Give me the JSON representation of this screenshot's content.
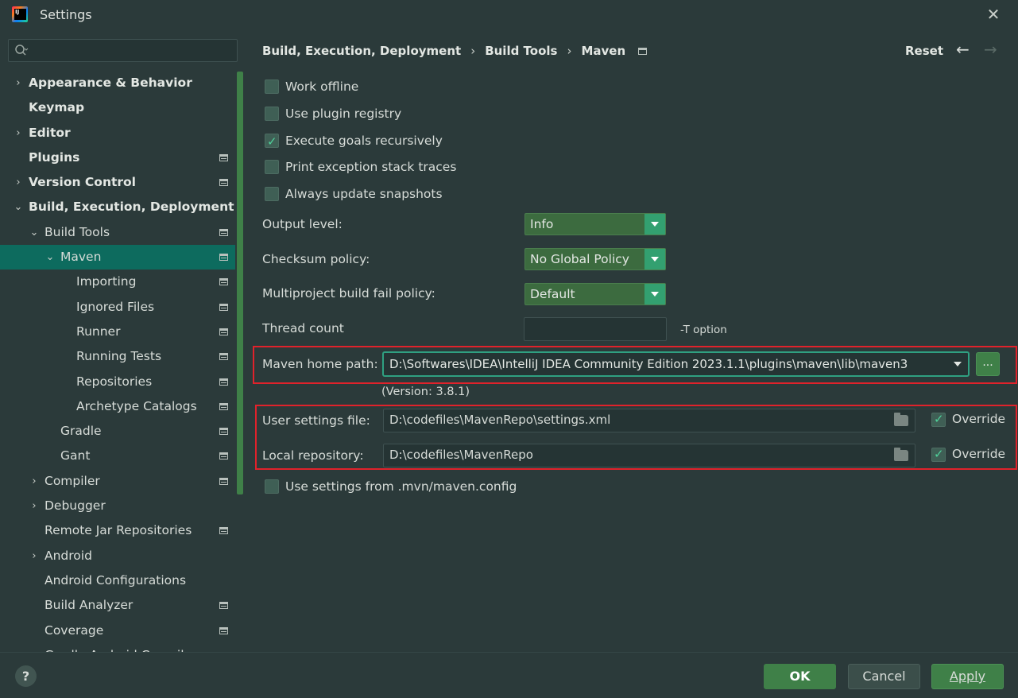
{
  "window": {
    "title": "Settings"
  },
  "search": {
    "placeholder": ""
  },
  "tree": [
    {
      "label": "Appearance & Behavior",
      "arrow": "›",
      "indent": 0,
      "bold": true,
      "proj": false,
      "selected": false
    },
    {
      "label": "Keymap",
      "arrow": "",
      "indent": 0,
      "bold": true,
      "proj": false,
      "selected": false
    },
    {
      "label": "Editor",
      "arrow": "›",
      "indent": 0,
      "bold": true,
      "proj": false,
      "selected": false
    },
    {
      "label": "Plugins",
      "arrow": "",
      "indent": 0,
      "bold": true,
      "proj": true,
      "selected": false
    },
    {
      "label": "Version Control",
      "arrow": "›",
      "indent": 0,
      "bold": true,
      "proj": true,
      "selected": false
    },
    {
      "label": "Build, Execution, Deployment",
      "arrow": "⌄",
      "indent": 0,
      "bold": true,
      "proj": false,
      "selected": false
    },
    {
      "label": "Build Tools",
      "arrow": "⌄",
      "indent": 1,
      "bold": false,
      "proj": true,
      "selected": false
    },
    {
      "label": "Maven",
      "arrow": "⌄",
      "indent": 2,
      "bold": false,
      "proj": true,
      "selected": true
    },
    {
      "label": "Importing",
      "arrow": "",
      "indent": 3,
      "bold": false,
      "proj": true,
      "selected": false
    },
    {
      "label": "Ignored Files",
      "arrow": "",
      "indent": 3,
      "bold": false,
      "proj": true,
      "selected": false
    },
    {
      "label": "Runner",
      "arrow": "",
      "indent": 3,
      "bold": false,
      "proj": true,
      "selected": false
    },
    {
      "label": "Running Tests",
      "arrow": "",
      "indent": 3,
      "bold": false,
      "proj": true,
      "selected": false
    },
    {
      "label": "Repositories",
      "arrow": "",
      "indent": 3,
      "bold": false,
      "proj": true,
      "selected": false
    },
    {
      "label": "Archetype Catalogs",
      "arrow": "",
      "indent": 3,
      "bold": false,
      "proj": true,
      "selected": false
    },
    {
      "label": "Gradle",
      "arrow": "",
      "indent": 2,
      "bold": false,
      "proj": true,
      "selected": false
    },
    {
      "label": "Gant",
      "arrow": "",
      "indent": 2,
      "bold": false,
      "proj": true,
      "selected": false
    },
    {
      "label": "Compiler",
      "arrow": "›",
      "indent": 1,
      "bold": false,
      "proj": true,
      "selected": false
    },
    {
      "label": "Debugger",
      "arrow": "›",
      "indent": 1,
      "bold": false,
      "proj": false,
      "selected": false
    },
    {
      "label": "Remote Jar Repositories",
      "arrow": "",
      "indent": 1,
      "bold": false,
      "proj": true,
      "selected": false
    },
    {
      "label": "Android",
      "arrow": "›",
      "indent": 1,
      "bold": false,
      "proj": false,
      "selected": false
    },
    {
      "label": "Android Configurations",
      "arrow": "",
      "indent": 1,
      "bold": false,
      "proj": false,
      "selected": false
    },
    {
      "label": "Build Analyzer",
      "arrow": "",
      "indent": 1,
      "bold": false,
      "proj": true,
      "selected": false
    },
    {
      "label": "Coverage",
      "arrow": "",
      "indent": 1,
      "bold": false,
      "proj": true,
      "selected": false
    },
    {
      "label": "Gradle-Android Compiler",
      "arrow": "",
      "indent": 1,
      "bold": false,
      "proj": true,
      "selected": false
    }
  ],
  "breadcrumb": {
    "item1": "Build, Execution, Deployment",
    "item2": "Build Tools",
    "item3": "Maven",
    "sep": "›"
  },
  "header": {
    "reset": "Reset",
    "back": "←",
    "forward": "→"
  },
  "options": {
    "work_offline": "Work offline",
    "use_plugin_registry": "Use plugin registry",
    "execute_goals_recursively": "Execute goals recursively",
    "print_exception_stack_traces": "Print exception stack traces",
    "always_update_snapshots": "Always update snapshots",
    "use_mvn_config": "Use settings from .mvn/maven.config"
  },
  "form": {
    "output_level_label": "Output level:",
    "output_level_value": "Info",
    "checksum_policy_label": "Checksum policy:",
    "checksum_policy_value": "No Global Policy",
    "fail_policy_label": "Multiproject build fail policy:",
    "fail_policy_value": "Default",
    "thread_count_label": "Thread count",
    "thread_count_value": "",
    "t_option": "-T option",
    "maven_home_label": "Maven home path:",
    "maven_home_value": "D:\\Softwares\\IDEA\\IntelliJ IDEA Community Edition 2023.1.1\\plugins\\maven\\lib\\maven3",
    "browse_label": "...",
    "version": "(Version: 3.8.1)",
    "user_settings_label": "User settings file:",
    "user_settings_value": "D:\\codefiles\\MavenRepo\\settings.xml",
    "local_repo_label": "Local repository:",
    "local_repo_value": "D:\\codefiles\\MavenRepo",
    "override_label": "Override"
  },
  "footer": {
    "help": "?",
    "ok": "OK",
    "cancel": "Cancel",
    "apply": "Apply"
  },
  "colors": {
    "accent": "#3f8048",
    "selection": "#0d6b5e",
    "highlight_box": "#e0222b",
    "background": "#2b3a3a"
  }
}
